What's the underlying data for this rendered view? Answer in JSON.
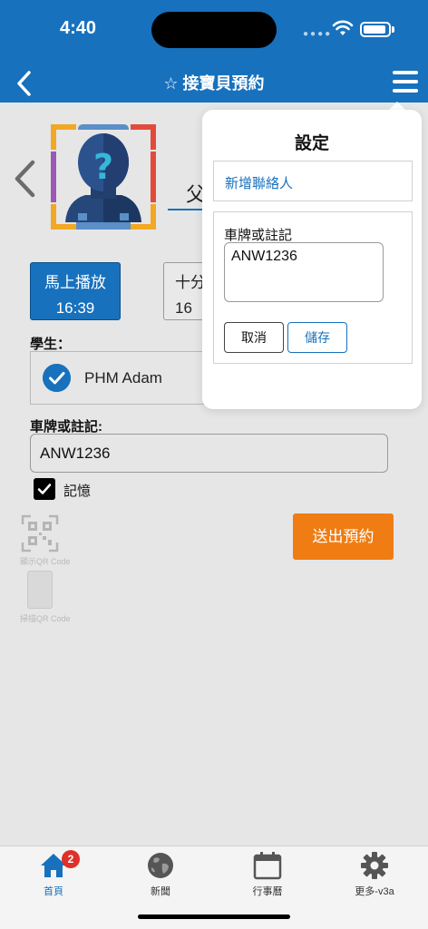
{
  "status_bar": {
    "time": "4:40"
  },
  "nav": {
    "title": "☆ 接寶貝預約"
  },
  "colors": {
    "primary": "#1771bd",
    "accent": "#ef7d14",
    "badge": "#e0302a"
  },
  "page": {
    "parent_label": "父",
    "time_buttons": [
      {
        "label": "馬上播放",
        "time": "16:39"
      },
      {
        "label": "十分",
        "time": "16"
      }
    ],
    "student_label": "學生：",
    "student_name": "PHM Adam",
    "plate_label": "車牌或註記:",
    "plate_value": "ANW1236",
    "remember_label": "記憶",
    "remember_checked": true,
    "submit_label": "送出預約",
    "qr_show_label": "顯示QR Code",
    "qr_scan_label": "掃描QR Code"
  },
  "popover": {
    "title": "設定",
    "add_contact": "新增聯絡人",
    "note_label": "車牌或註記",
    "note_value": "ANW1236",
    "cancel": "取消",
    "save": "儲存"
  },
  "tabs": [
    {
      "label": "首頁",
      "icon": "home-icon",
      "badge": "2",
      "active": true
    },
    {
      "label": "新聞",
      "icon": "globe-icon"
    },
    {
      "label": "行事曆",
      "icon": "calendar-icon"
    },
    {
      "label": "更多-v3a",
      "icon": "gear-icon"
    }
  ]
}
